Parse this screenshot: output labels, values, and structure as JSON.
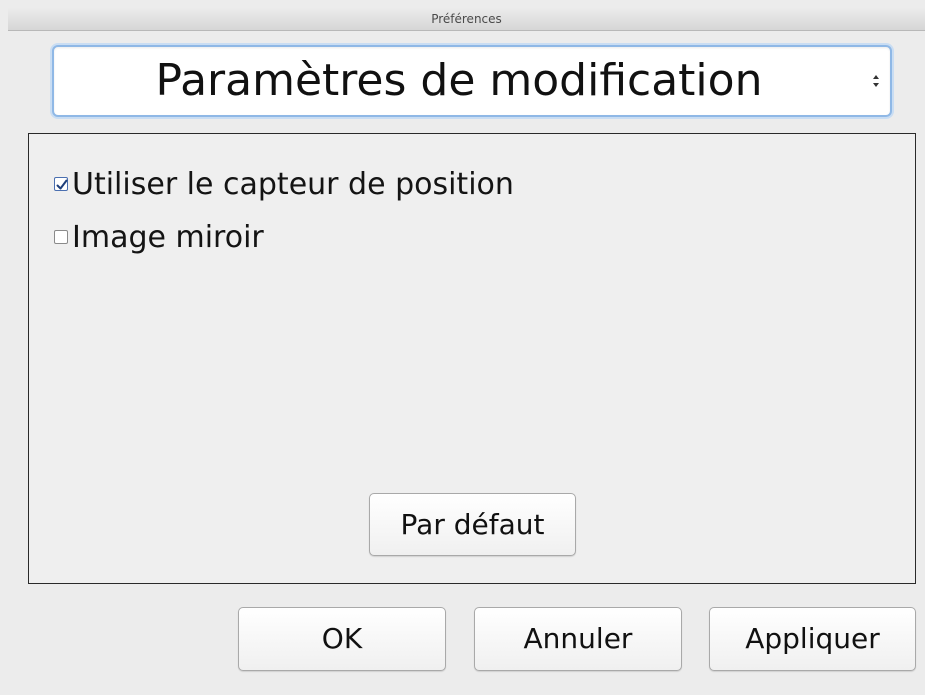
{
  "window": {
    "title": "Préférences"
  },
  "category_select": {
    "selected": "Paramètres de modification"
  },
  "options": [
    {
      "label": "Utiliser le capteur de position",
      "checked": true
    },
    {
      "label": "Image miroir",
      "checked": false
    }
  ],
  "panel": {
    "default_button": "Par défaut"
  },
  "footer": {
    "ok_label": "OK",
    "cancel_label": "Annuler",
    "apply_label": "Appliquer"
  },
  "colors": {
    "select_focus_ring": "#8fb8e6",
    "panel_border": "#2a2a2a",
    "checkbox_checked": "#4a6fb0"
  }
}
